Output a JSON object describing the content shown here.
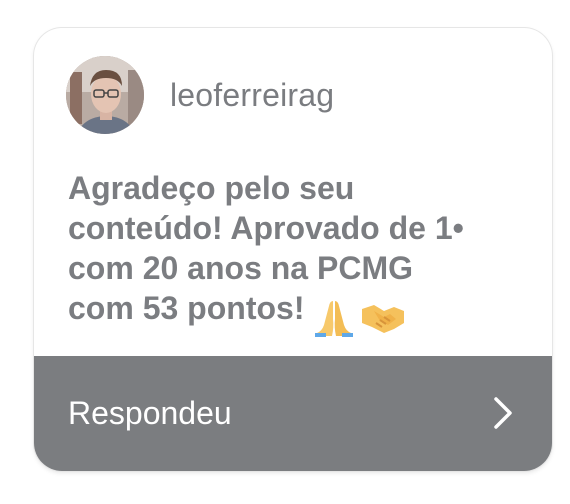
{
  "comment": {
    "username": "leoferreirag",
    "avatar_icon": "user-avatar-photo",
    "message": "Agradeço pelo seu\nconteúdo! Aprovado de 1•\ncom 20 anos na PCMG\ncom 53 pontos!",
    "emojis": [
      "folded-hands-icon",
      "handshake-icon"
    ]
  },
  "footer": {
    "reply_label": "Respondeu",
    "chevron_icon": "chevron-right-icon"
  },
  "colors": {
    "footer_bg": "#7b7d80",
    "text_gray": "#7b7d81"
  }
}
